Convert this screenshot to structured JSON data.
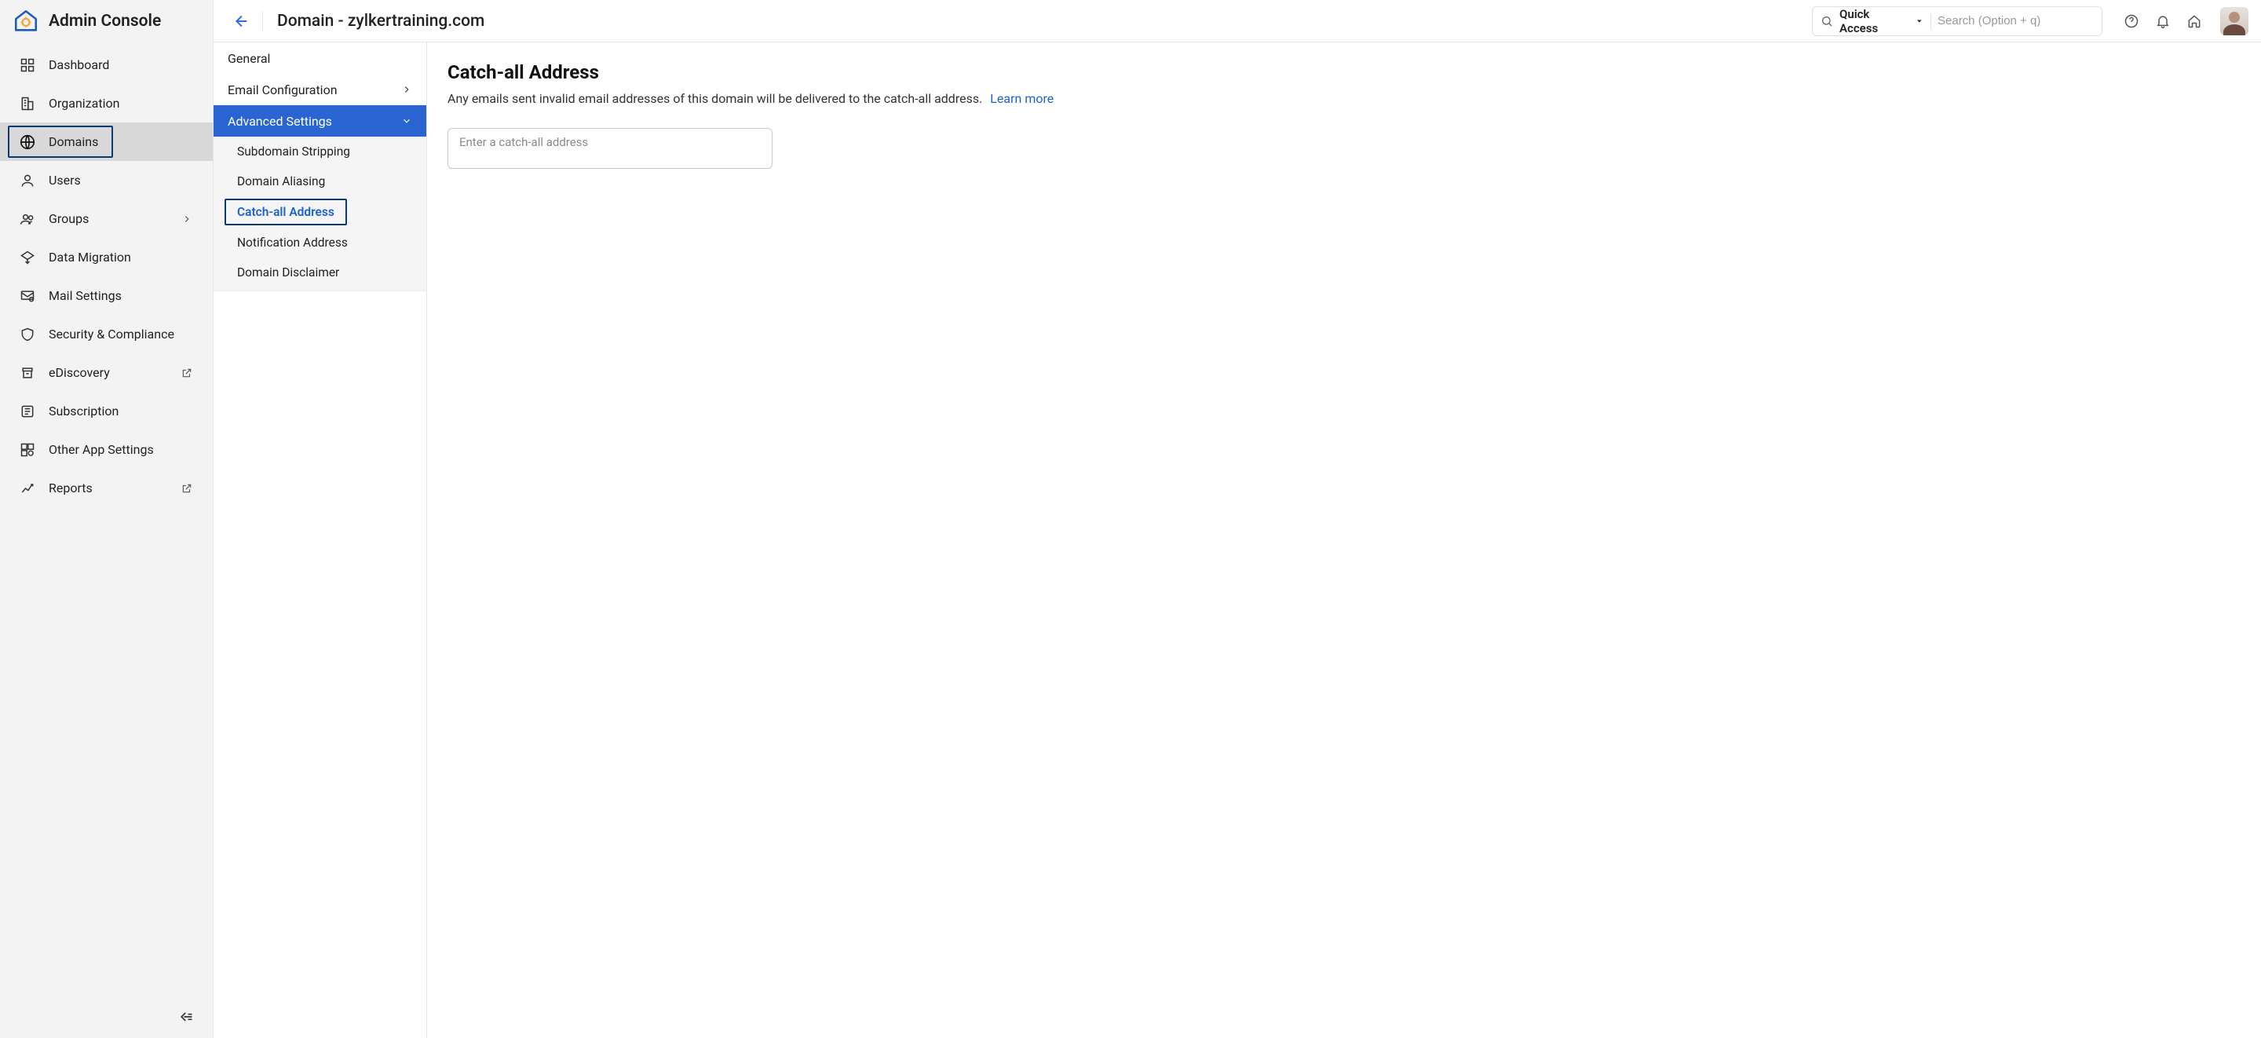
{
  "brand": {
    "title": "Admin Console"
  },
  "sidebar": {
    "items": [
      {
        "label": "Dashboard",
        "icon": "dashboard"
      },
      {
        "label": "Organization",
        "icon": "organization"
      },
      {
        "label": "Domains",
        "icon": "globe",
        "active": true
      },
      {
        "label": "Users",
        "icon": "user"
      },
      {
        "label": "Groups",
        "icon": "users",
        "chevron": true
      },
      {
        "label": "Data Migration",
        "icon": "migration"
      },
      {
        "label": "Mail Settings",
        "icon": "mail-settings"
      },
      {
        "label": "Security & Compliance",
        "icon": "shield"
      },
      {
        "label": "eDiscovery",
        "icon": "archive",
        "external": true
      },
      {
        "label": "Subscription",
        "icon": "subscription"
      },
      {
        "label": "Other App Settings",
        "icon": "apps"
      },
      {
        "label": "Reports",
        "icon": "chart",
        "external": true
      }
    ]
  },
  "header": {
    "page_title": "Domain - zylkertraining.com",
    "quick_access_label": "Quick Access",
    "search_placeholder": "Search (Option + q)"
  },
  "subnav": {
    "general": "General",
    "email_config": "Email Configuration",
    "advanced": "Advanced Settings",
    "sub_items": {
      "subdomain_stripping": "Subdomain Stripping",
      "domain_aliasing": "Domain Aliasing",
      "catch_all": "Catch-all Address",
      "notification_address": "Notification Address",
      "domain_disclaimer": "Domain Disclaimer"
    }
  },
  "content": {
    "title": "Catch-all Address",
    "description": "Any emails sent invalid email addresses of this domain will be delivered to the catch-all address.",
    "learn_more": "Learn more",
    "input_placeholder": "Enter a catch-all address"
  }
}
